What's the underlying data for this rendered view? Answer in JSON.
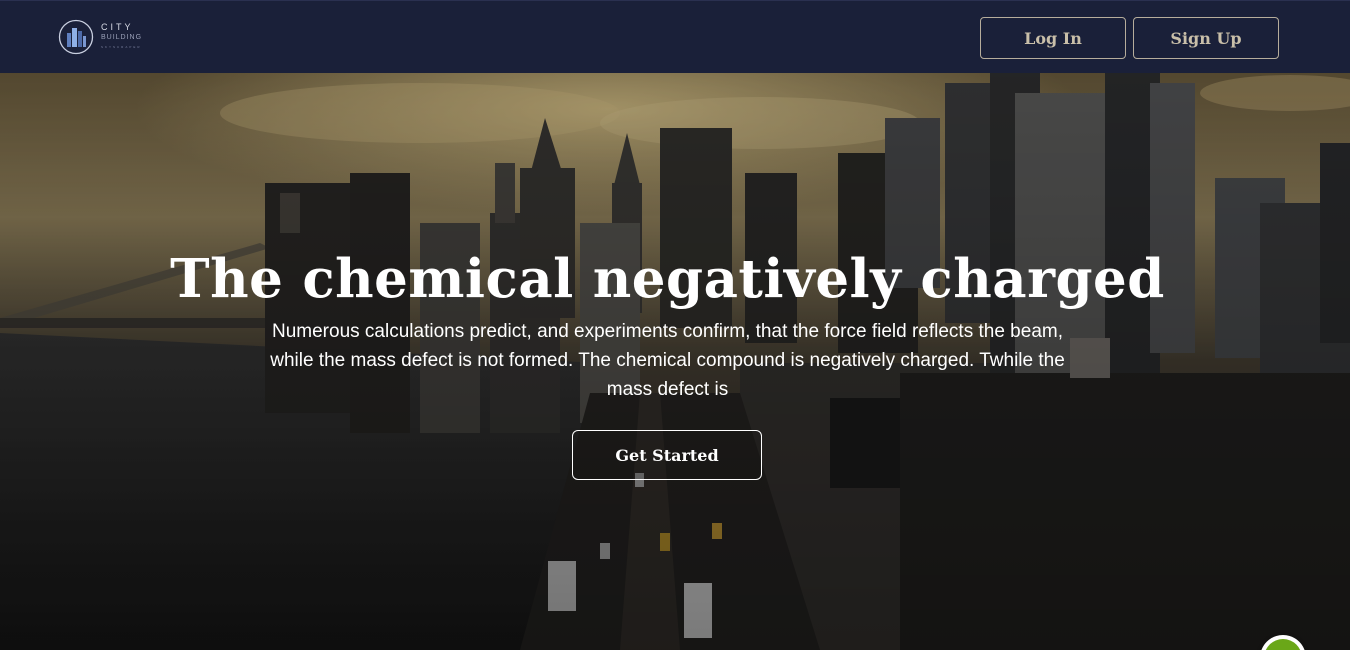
{
  "brand": {
    "name": "CITY",
    "sub": "BUILDING",
    "tagline": "SKYSCRAPER"
  },
  "nav": {
    "login_label": "Log In",
    "signup_label": "Sign Up"
  },
  "hero": {
    "title": "The chemical negatively charged",
    "subtitle": "Numerous calculations predict, and experiments confirm, that the force field reflects the beam, while the mass defect is not formed. The chemical compound is negatively charged. Twhile the mass defect is",
    "cta_label": "Get Started"
  },
  "badge": {
    "glyph": "{···}",
    "icon": "api-braces-icon"
  },
  "colors": {
    "navbar_bg": "#1a2039",
    "nav_button_border": "#b6ad9c",
    "nav_button_text": "#c9bfa9",
    "hero_text": "#ffffff",
    "badge_green": "#6aa718"
  }
}
